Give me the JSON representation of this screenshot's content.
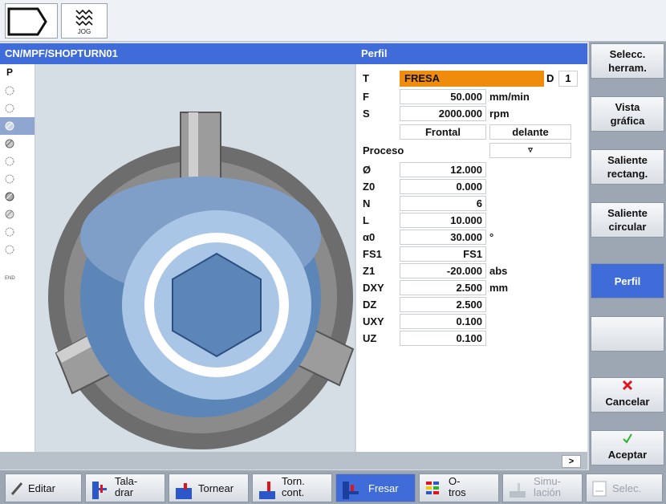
{
  "topbar": {
    "jog_label": "JOG"
  },
  "titlebar": {
    "path": "CN/MPF/SHOPTURN01",
    "form_title": "Perfil"
  },
  "steps": {
    "first": "P",
    "end": "END"
  },
  "form": {
    "tool": {
      "label": "T",
      "value": "FRESA",
      "d_label": "D",
      "d_value": "1"
    },
    "feed": {
      "label": "F",
      "value": "50.000",
      "unit": "mm/min"
    },
    "speed": {
      "label": "S",
      "value": "2000.000",
      "unit": "rpm"
    },
    "plane": {
      "value": "Frontal",
      "position": "delante"
    },
    "process": {
      "label": "Proceso",
      "value": "▿"
    },
    "rows": [
      {
        "label": "Ø",
        "value": "12.000",
        "unit": ""
      },
      {
        "label": "Z0",
        "value": "0.000",
        "unit": ""
      },
      {
        "label": "N",
        "value": "6",
        "unit": ""
      },
      {
        "label": "L",
        "value": "10.000",
        "unit": ""
      },
      {
        "label": "α0",
        "value": "30.000",
        "unit": "°"
      },
      {
        "label": "FS1",
        "value": "FS1",
        "unit": ""
      },
      {
        "label": "Z1",
        "value": "-20.000",
        "unit": "abs"
      },
      {
        "label": "DXY",
        "value": "2.500",
        "unit": "mm"
      },
      {
        "label": "DZ",
        "value": "2.500",
        "unit": ""
      },
      {
        "label": "UXY",
        "value": "0.100",
        "unit": ""
      },
      {
        "label": "UZ",
        "value": "0.100",
        "unit": ""
      }
    ]
  },
  "scroll_label": ">",
  "vsoftkeys": {
    "k1": "Selecc. herram.",
    "k2": "Vista gráfica",
    "k3": "Saliente rectang.",
    "k4": "Saliente circular",
    "k5": "Perfil",
    "k6": "",
    "k7": "Cancelar",
    "k8": "Aceptar"
  },
  "hsoftkeys": {
    "editar": "Editar",
    "taladrar_1": "Tala-",
    "taladrar_2": "drar",
    "tornear": "Tornear",
    "torn_cont_1": "Torn.",
    "torn_cont_2": "cont.",
    "fresar": "Fresar",
    "otros_1": "O-",
    "otros_2": "tros",
    "simulacion_1": "Simu-",
    "simulacion_2": "lación",
    "selec": "Selec."
  },
  "colors": {
    "title_blue": "#3f6cd8",
    "tool_orange": "#f08c0c"
  }
}
